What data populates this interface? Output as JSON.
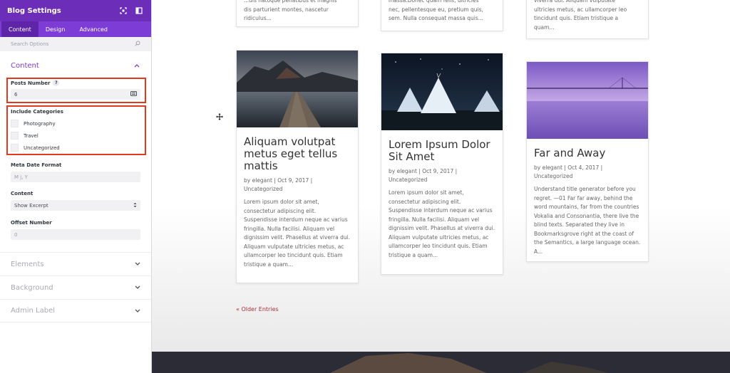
{
  "sidebar": {
    "title": "Blog Settings",
    "tabs": [
      "Content",
      "Design",
      "Advanced"
    ],
    "search_placeholder": "Search Options",
    "content_section": "Content",
    "posts_number_label": "Posts Number",
    "posts_number_help": "?",
    "posts_number_value": "6",
    "include_categories_label": "Include Categories",
    "categories": [
      "Photography",
      "Travel",
      "Uncategorized"
    ],
    "meta_date_label": "Meta Date Format",
    "meta_date_value": "M j, Y",
    "content_label": "Content",
    "content_value": "Show Excerpt",
    "offset_label": "Offset Number",
    "offset_value": "0",
    "collapsed_sections": [
      "Elements",
      "Background",
      "Admin Label"
    ],
    "colors": {
      "header": "#6c2eb9",
      "tabs": "#7d3cd6",
      "highlight": "#e3391f"
    }
  },
  "main": {
    "top_excerpts": [
      "...dis natoque penatibus et magnis\ndis parturient montes, nascetur\nridiculus...",
      "massa.Donec quam felis, ultricies\nnec, pellentesque eu, pretium quis,\nsem. Nulla consequat massa quis...",
      "viverra dui. Aliquam vulputate\nultricies metus, ac ullamcorper leo\ntincidunt quis. Etiam tristique a\nquam..."
    ],
    "posts": [
      {
        "title": "Aliquam volutpat metus eget tellus mattis",
        "meta": "by elegant | Oct 9, 2017 | Uncategorized",
        "excerpt": "Lorem ipsum dolor sit amet, consectetur adipiscing elit. Suspendisse interdum neque ac varius fringilla. Nulla facilisi. Aliquam vel dignissim velit. Phasellus at viverra dui. Aliquam vulputate ultricies metus, ac ullamcorper leo tincidunt quis. Etiam tristique a quam..."
      },
      {
        "title": "Lorem Ipsum Dolor Sit Amet",
        "meta": "by elegant | Oct 9, 2017 | Uncategorized",
        "excerpt": "Lorem ipsum dolor sit amet, consectetur adipiscing elit. Suspendisse interdum neque ac varius fringilla. Nulla facilisi. Aliquam vel dignissim velit. Phasellus at viverra dui. Aliquam vulputate ultricies metus, ac ullamcorper leo tincidunt quis. Etiam tristique a quam..."
      },
      {
        "title": "Far and Away",
        "meta": "by elegant | Oct 4, 2017 | Uncategorized",
        "excerpt": "Understand title generator before you regret. —01 Far far away, behind the word mountains, far from the countries Vokalia and Consonantia, there live the blind texts. Separated they live in Bookmarksgrove right at the coast of the Semantics, a large language ocean. A..."
      }
    ],
    "older_entries": "« Older Entries"
  }
}
